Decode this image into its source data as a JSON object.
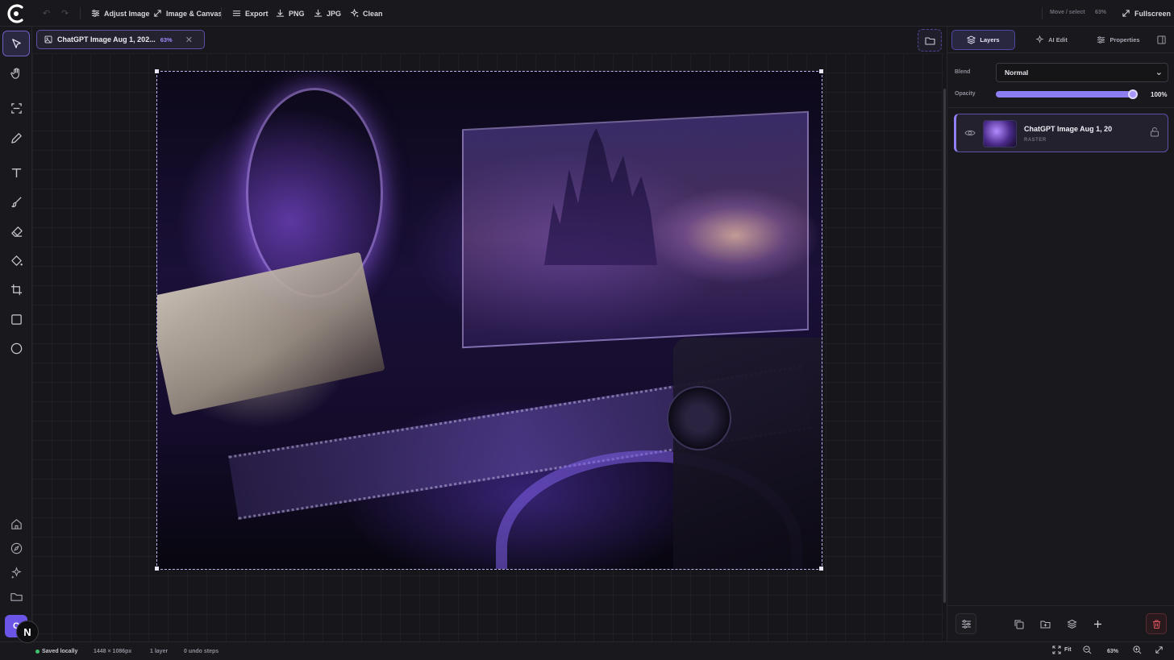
{
  "toolbar": {
    "undo_icon": "undo-icon",
    "redo_icon": "redo-icon",
    "adjust_image": "Adjust Image",
    "image_canvas": "Image & Canvas",
    "export": "Export",
    "png": "PNG",
    "jpg": "JPG",
    "clean": "Clean",
    "mode": "Move / select",
    "zoom": "63%",
    "fullscreen": "Fullscreen"
  },
  "left_tools": [
    "select-tool",
    "hand-tool",
    "scan-tool",
    "pencil-tool",
    "text-tool",
    "brush-tool",
    "eraser-tool",
    "fill-tool",
    "crop-tool",
    "rectangle-tool",
    "ellipse-tool"
  ],
  "left_nav": [
    "home",
    "explore",
    "ai-sparkles",
    "folder"
  ],
  "document_tab": {
    "title": "ChatGPT Image Aug 1, 202...",
    "zoom": "63%"
  },
  "right_panel": {
    "tabs": [
      "Layers",
      "AI Edit",
      "Properties"
    ],
    "active_tab": "Layers",
    "blend_label": "Blend",
    "blend_value": "Normal",
    "opacity_label": "Opacity",
    "opacity_value": "100%",
    "opacity_level": 1.0
  },
  "layers": [
    {
      "name": "ChatGPT Image Aug 1, 20",
      "type": "RASTER",
      "visible": true,
      "locked": false
    }
  ],
  "status": {
    "saved": "Saved locally",
    "dimensions": "1448 × 1086px",
    "layers": "1 layer",
    "undo": "0 undo steps",
    "fit": "Fit",
    "zoom": "63%"
  },
  "avatar_initial": "N",
  "colors": {
    "accent": "#8c7df2",
    "background": "#17171b",
    "panel": "#19191d",
    "saved_dot": "#3ec46d",
    "danger": "#e0555f"
  }
}
